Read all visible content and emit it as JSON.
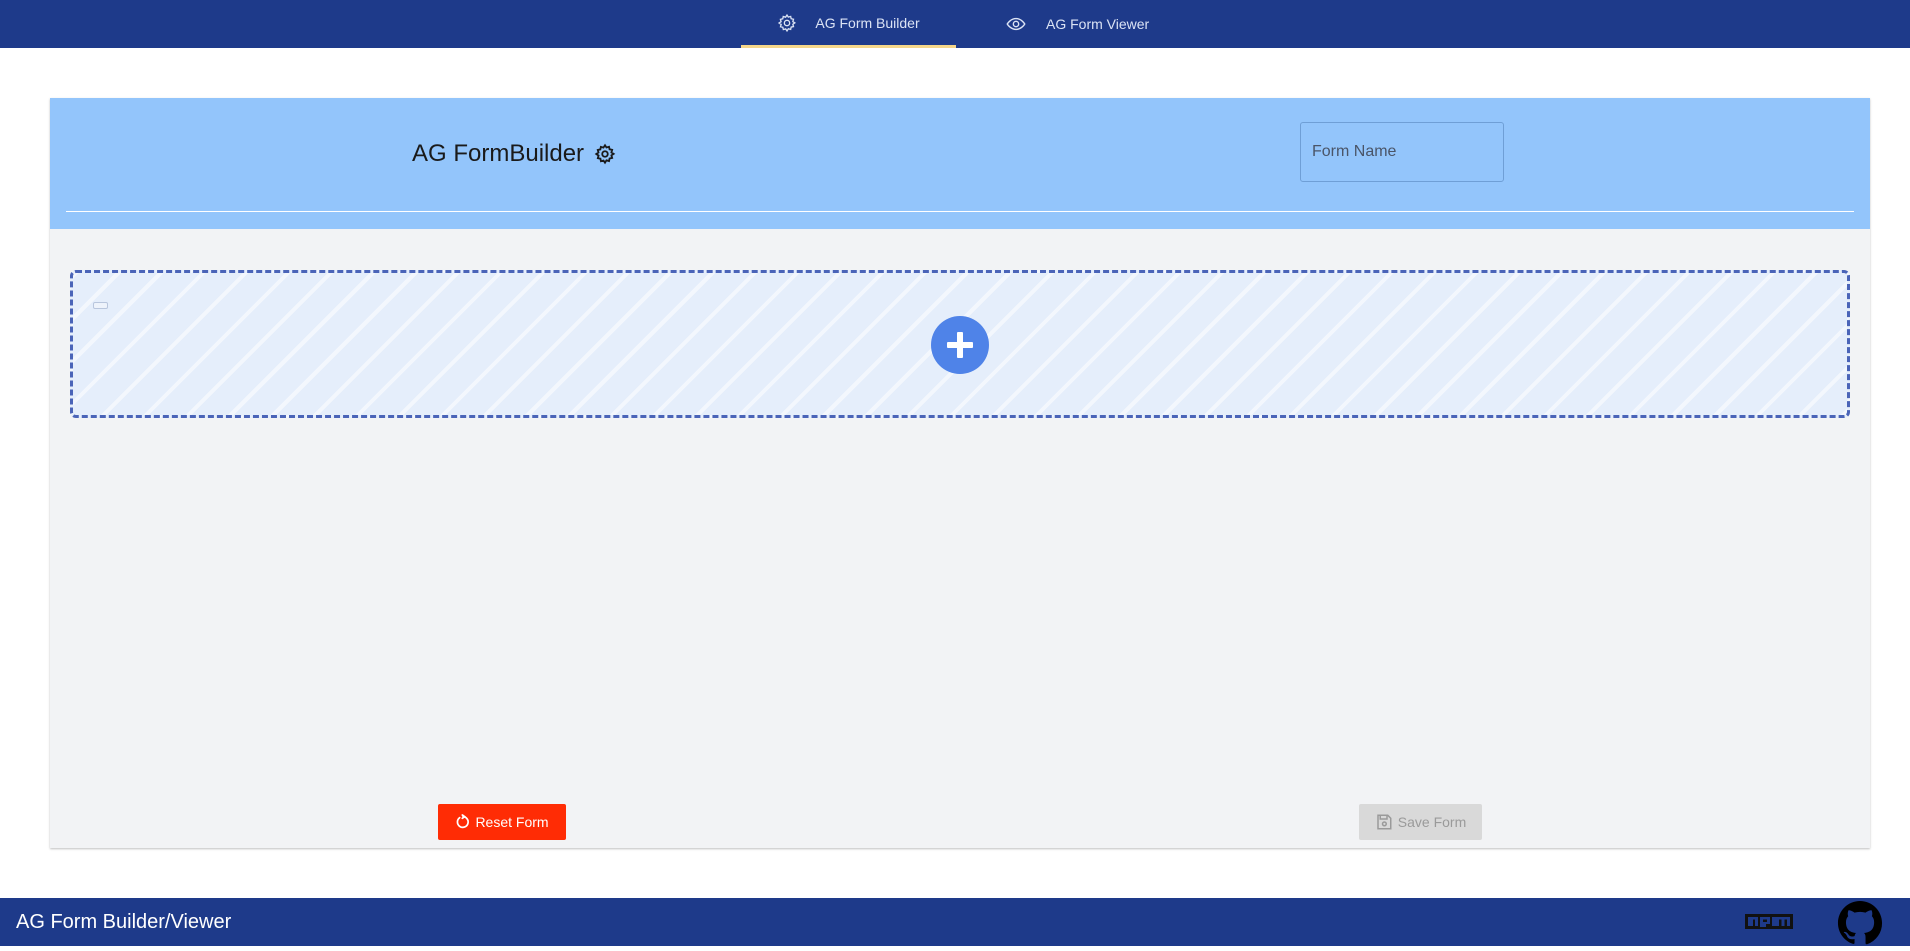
{
  "nav": {
    "tabs": [
      {
        "label": "AG Form Builder",
        "icon": "gear-icon",
        "active": true
      },
      {
        "label": "AG Form Viewer",
        "icon": "eye-icon",
        "active": false
      }
    ]
  },
  "builder": {
    "title": "AG FormBuilder",
    "title_icon": "gear-icon",
    "form_name": {
      "placeholder": "Form Name",
      "value": ""
    },
    "dropzone": {
      "add_icon": "plus-circle-icon"
    },
    "reset_label": "Reset Form",
    "save_label": "Save Form",
    "save_enabled": false
  },
  "footer": {
    "title": "AG Form Builder/Viewer",
    "icons": [
      "npm-icon",
      "github-icon"
    ]
  },
  "colors": {
    "nav_bg": "#1e3a8a",
    "header_bg": "#93c5fb",
    "active_tab_underline": "#f5d68a",
    "reset_button": "#ff2c05",
    "add_button": "#4f83e8",
    "dropzone_border": "#4a64b8"
  }
}
